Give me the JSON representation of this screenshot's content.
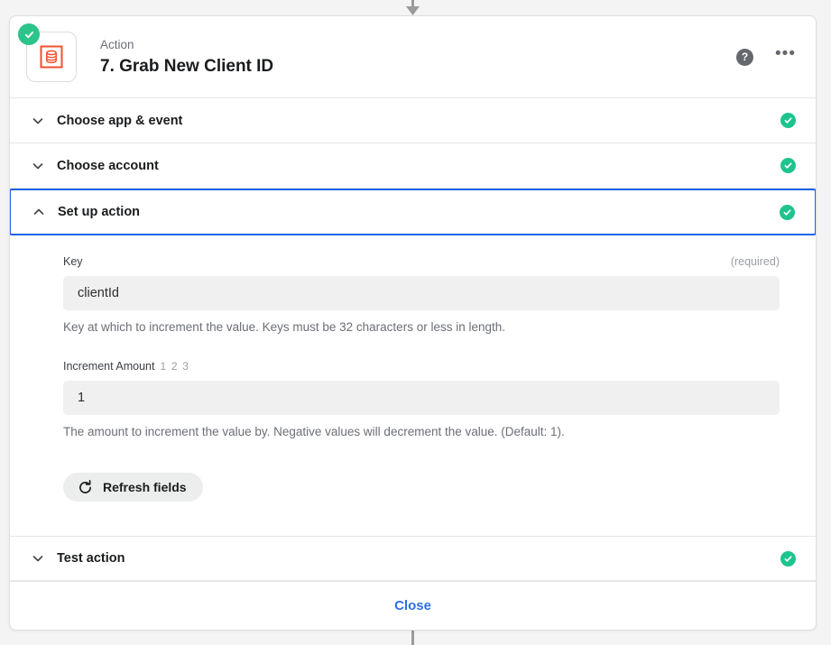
{
  "header": {
    "kicker": "Action",
    "title": "7. Grab New Client ID",
    "app_icon_name": "database-icon",
    "status": "complete",
    "help_label": "?",
    "more_label": "•••"
  },
  "sections": [
    {
      "label": "Choose app & event",
      "expanded": false,
      "status": "complete"
    },
    {
      "label": "Choose account",
      "expanded": false,
      "status": "complete"
    },
    {
      "label": "Set up action",
      "expanded": true,
      "status": "complete"
    },
    {
      "label": "Test action",
      "expanded": false,
      "status": "complete"
    }
  ],
  "setup_form": {
    "fields": [
      {
        "label": "Key",
        "type_hint": "",
        "required_label": "(required)",
        "value": "clientId",
        "placeholder": "",
        "help": "Key at which to increment the value. Keys must be 32 characters or less in length."
      },
      {
        "label": "Increment Amount",
        "type_hint": "1 2 3",
        "required_label": "",
        "value": "1",
        "placeholder": "",
        "help": "The amount to increment the value by. Negative values will decrement the value. (Default: 1)."
      }
    ],
    "refresh_button": "Refresh fields"
  },
  "footer": {
    "close_label": "Close"
  },
  "colors": {
    "accent_blue": "#1f64e7",
    "link_blue": "#2f6fe4",
    "success_green": "#1ec48e",
    "app_orange": "#f2512e",
    "page_background": "#f4f4f4",
    "input_background": "#f0f0f0"
  }
}
